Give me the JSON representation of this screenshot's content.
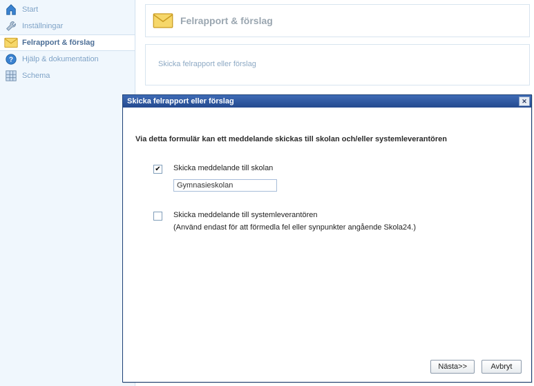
{
  "sidebar": {
    "items": [
      {
        "label": "Start",
        "icon": "home-icon"
      },
      {
        "label": "Inställningar",
        "icon": "wrench-icon"
      },
      {
        "label": "Felrapport & förslag",
        "icon": "envelope-icon"
      },
      {
        "label": "Hjälp & dokumentation",
        "icon": "help-icon"
      },
      {
        "label": "Schema",
        "icon": "grid-icon"
      }
    ],
    "active_index": 2
  },
  "header": {
    "title": "Felrapport & förslag"
  },
  "content": {
    "intro": "Skicka felrapport eller förslag"
  },
  "dialog": {
    "title": "Skicka felrapport eller förslag",
    "intro": "Via detta formulär kan ett meddelande skickas till skolan och/eller systemleverantören",
    "option_school": {
      "label": "Skicka meddelande till skolan",
      "checked": true,
      "value": "Gymnasieskolan"
    },
    "option_vendor": {
      "label": "Skicka meddelande till systemleverantören",
      "checked": false,
      "note": "(Använd endast för att förmedla fel eller synpunkter angående Skola24.)"
    },
    "buttons": {
      "next": "Nästa>>",
      "cancel": "Avbryt"
    },
    "checkmark": "✔"
  }
}
